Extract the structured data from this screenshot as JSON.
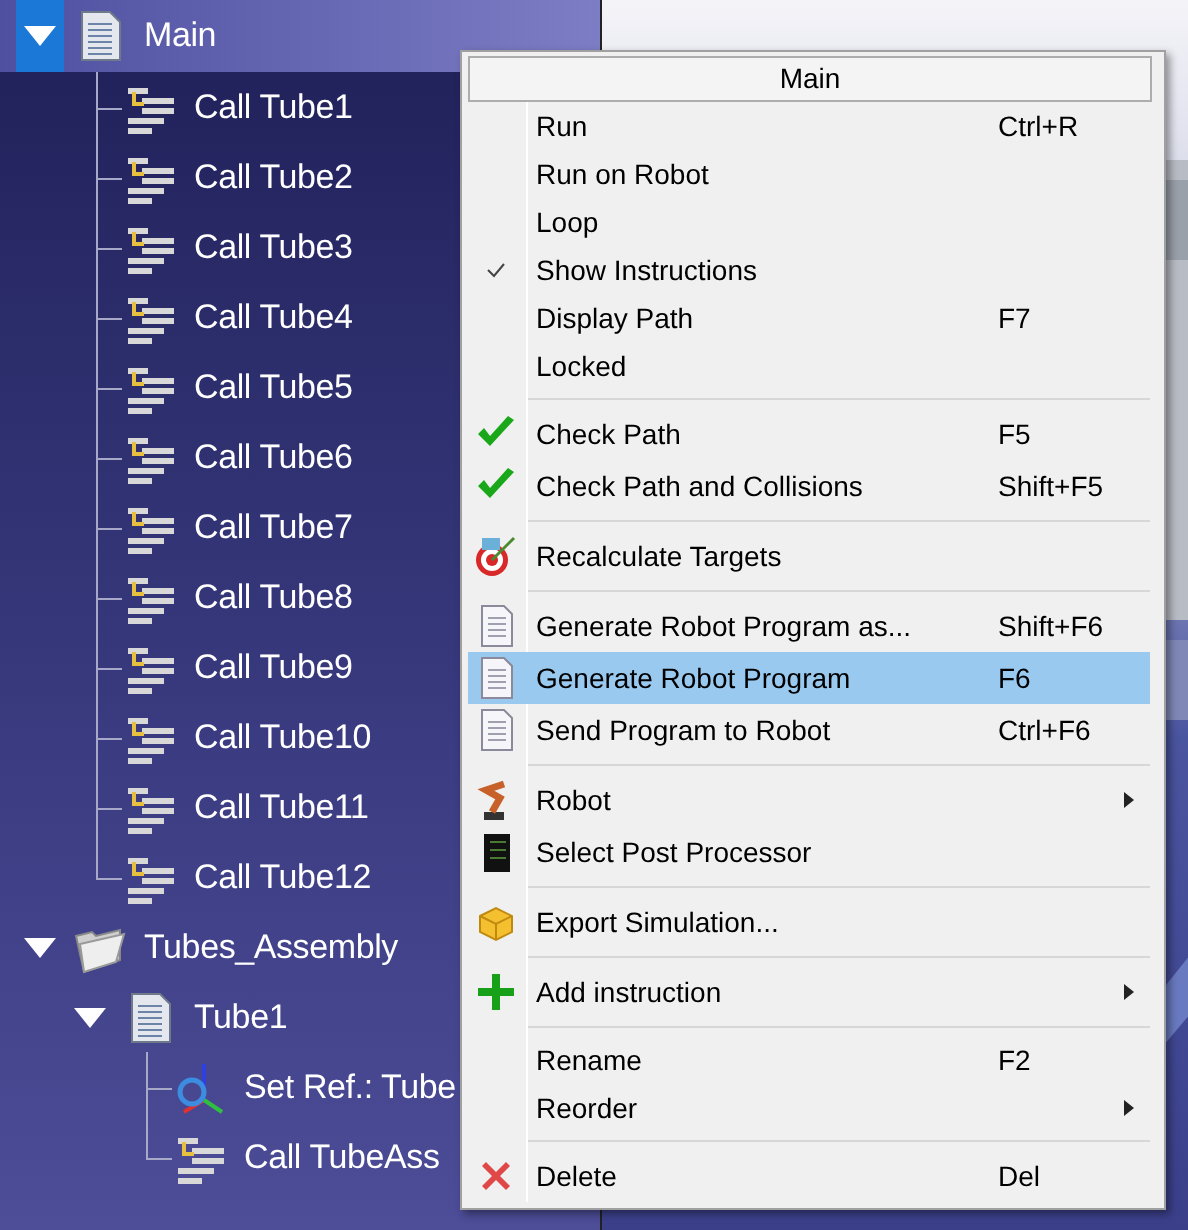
{
  "tree": [
    {
      "label": "Main",
      "kind": "program",
      "expanded": true,
      "selected": true,
      "children": [
        {
          "label": "Call Tube1",
          "kind": "call",
          "selected": false
        },
        {
          "label": "Call Tube2",
          "kind": "call",
          "selected": false
        },
        {
          "label": "Call Tube3",
          "kind": "call",
          "selected": false
        },
        {
          "label": "Call Tube4",
          "kind": "call",
          "selected": false
        },
        {
          "label": "Call Tube5",
          "kind": "call",
          "selected": false
        },
        {
          "label": "Call Tube6",
          "kind": "call",
          "selected": false
        },
        {
          "label": "Call Tube7",
          "kind": "call",
          "selected": false
        },
        {
          "label": "Call Tube8",
          "kind": "call",
          "selected": false
        },
        {
          "label": "Call Tube9",
          "kind": "call",
          "selected": false
        },
        {
          "label": "Call Tube10",
          "kind": "call",
          "selected": false
        },
        {
          "label": "Call Tube11",
          "kind": "call",
          "selected": false
        },
        {
          "label": "Call Tube12",
          "kind": "call",
          "selected": false
        }
      ]
    },
    {
      "label": "Tubes_Assembly",
      "kind": "folder",
      "expanded": true,
      "selected": false,
      "children": [
        {
          "label": "Tube1",
          "kind": "program",
          "expanded": true,
          "selected": false,
          "children": [
            {
              "label": "Set Ref.: Tube",
              "kind": "frame",
              "selected": false
            },
            {
              "label": "Call TubeAss",
              "kind": "call",
              "selected": false
            }
          ]
        }
      ]
    }
  ],
  "menu": {
    "title": "Main",
    "items": [
      {
        "kind": "plain",
        "label": "Run",
        "shortcut": "Ctrl+R",
        "checked": false,
        "selected": false,
        "submenu": false
      },
      {
        "kind": "plain",
        "label": "Run on Robot",
        "checked": false,
        "selected": false,
        "submenu": false
      },
      {
        "kind": "plain",
        "label": "Loop",
        "checked": false,
        "selected": false,
        "submenu": false
      },
      {
        "kind": "plain",
        "label": "Show Instructions",
        "checked": true,
        "selected": false,
        "submenu": false
      },
      {
        "kind": "plain",
        "label": "Display Path",
        "shortcut": "F7",
        "checked": false,
        "selected": false,
        "submenu": false
      },
      {
        "kind": "plain",
        "label": "Locked",
        "checked": false,
        "selected": false,
        "submenu": false
      },
      {
        "kind": "separator"
      },
      {
        "kind": "verify",
        "label": "Check Path",
        "shortcut": "F5",
        "checked": false,
        "selected": false,
        "submenu": false
      },
      {
        "kind": "verify",
        "label": "Check Path and Collisions",
        "shortcut": "Shift+F5",
        "checked": false,
        "selected": false,
        "submenu": false
      },
      {
        "kind": "separator"
      },
      {
        "kind": "target",
        "label": "Recalculate Targets",
        "checked": false,
        "selected": false,
        "submenu": false
      },
      {
        "kind": "separator"
      },
      {
        "kind": "document",
        "label": "Generate Robot Program as...",
        "shortcut": "Shift+F6",
        "checked": false,
        "selected": false,
        "submenu": false
      },
      {
        "kind": "document",
        "label": "Generate Robot Program",
        "shortcut": "F6",
        "checked": false,
        "selected": true,
        "submenu": false
      },
      {
        "kind": "document",
        "label": "Send Program to Robot",
        "shortcut": "Ctrl+F6",
        "checked": false,
        "selected": false,
        "submenu": false
      },
      {
        "kind": "separator"
      },
      {
        "kind": "robot",
        "label": "Robot",
        "checked": false,
        "selected": false,
        "submenu": true
      },
      {
        "kind": "notebook",
        "label": "Select Post Processor",
        "checked": false,
        "selected": false,
        "submenu": false
      },
      {
        "kind": "separator"
      },
      {
        "kind": "package",
        "label": "Export Simulation...",
        "checked": false,
        "selected": false,
        "submenu": false
      },
      {
        "kind": "separator"
      },
      {
        "kind": "add",
        "label": "Add instruction",
        "checked": false,
        "selected": false,
        "submenu": true
      },
      {
        "kind": "separator"
      },
      {
        "kind": "plain",
        "label": "Rename",
        "shortcut": "F2",
        "checked": false,
        "selected": false,
        "submenu": false
      },
      {
        "kind": "plain",
        "label": "Reorder",
        "checked": false,
        "selected": false,
        "submenu": true
      },
      {
        "kind": "separator"
      },
      {
        "kind": "delete",
        "label": "Delete",
        "shortcut": "Del",
        "checked": false,
        "selected": false,
        "submenu": false
      }
    ]
  }
}
